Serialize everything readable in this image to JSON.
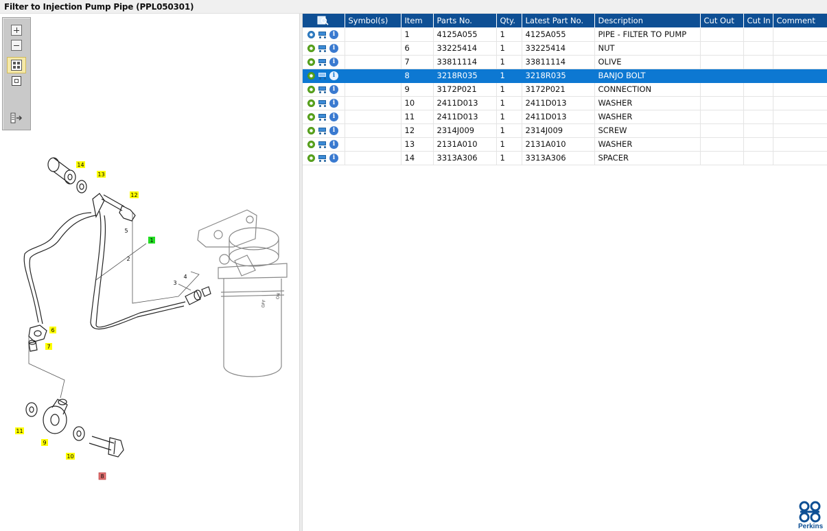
{
  "title": "Filter to Injection Pump Pipe (PPL050301)",
  "toolbar": {
    "zoom_in": "zoom-in-icon",
    "zoom_out": "zoom-out-icon",
    "view_multi": "multi-view-icon",
    "view_single": "single-view-icon",
    "export": "export-list-icon"
  },
  "table": {
    "headers": {
      "icons": "search-icon",
      "symbols": "Symbol(s)",
      "item": "Item",
      "parts_no": "Parts No.",
      "qty": "Qty.",
      "latest_part_no": "Latest Part No.",
      "description": "Description",
      "cut_out": "Cut Out",
      "cut_in": "Cut In",
      "comment": "Comment"
    },
    "rows": [
      {
        "item": "1",
        "parts_no": "4125A055",
        "qty": "1",
        "latest": "4125A055",
        "desc": "PIPE - FILTER TO PUMP",
        "cut_out": "",
        "cut_in": "",
        "comment": ""
      },
      {
        "item": "6",
        "parts_no": "33225414",
        "qty": "1",
        "latest": "33225414",
        "desc": "NUT",
        "cut_out": "",
        "cut_in": "",
        "comment": ""
      },
      {
        "item": "7",
        "parts_no": "33811114",
        "qty": "1",
        "latest": "33811114",
        "desc": "OLIVE",
        "cut_out": "",
        "cut_in": "",
        "comment": ""
      },
      {
        "item": "8",
        "parts_no": "3218R035",
        "qty": "1",
        "latest": "3218R035",
        "desc": "BANJO BOLT",
        "cut_out": "",
        "cut_in": "",
        "comment": ""
      },
      {
        "item": "9",
        "parts_no": "3172P021",
        "qty": "1",
        "latest": "3172P021",
        "desc": "CONNECTION",
        "cut_out": "",
        "cut_in": "",
        "comment": ""
      },
      {
        "item": "10",
        "parts_no": "2411D013",
        "qty": "1",
        "latest": "2411D013",
        "desc": "WASHER",
        "cut_out": "",
        "cut_in": "",
        "comment": ""
      },
      {
        "item": "11",
        "parts_no": "2411D013",
        "qty": "1",
        "latest": "2411D013",
        "desc": "WASHER",
        "cut_out": "",
        "cut_in": "",
        "comment": ""
      },
      {
        "item": "12",
        "parts_no": "2314J009",
        "qty": "1",
        "latest": "2314J009",
        "desc": "SCREW",
        "cut_out": "",
        "cut_in": "",
        "comment": ""
      },
      {
        "item": "13",
        "parts_no": "2131A010",
        "qty": "1",
        "latest": "2131A010",
        "desc": "WASHER",
        "cut_out": "",
        "cut_in": "",
        "comment": ""
      },
      {
        "item": "14",
        "parts_no": "3313A306",
        "qty": "1",
        "latest": "3313A306",
        "desc": "SPACER",
        "cut_out": "",
        "cut_in": "",
        "comment": ""
      }
    ],
    "selected_item": "8"
  },
  "diagram": {
    "callouts": {
      "c14": "14",
      "c13": "13",
      "c12": "12",
      "c5": "5",
      "c1": "1",
      "c2": "2",
      "c4": "4",
      "c3": "3",
      "c6": "6",
      "c7": "7",
      "c11": "11",
      "c9": "9",
      "c10": "10",
      "c8": "8",
      "filter_mark_a": "OFF",
      "filter_mark_b": "ON"
    },
    "colors": {
      "highlight_yellow": "#ffff00",
      "highlight_green": "#22dd22",
      "highlight_red": "#e07070"
    }
  },
  "logo": {
    "text": "Perkins"
  }
}
